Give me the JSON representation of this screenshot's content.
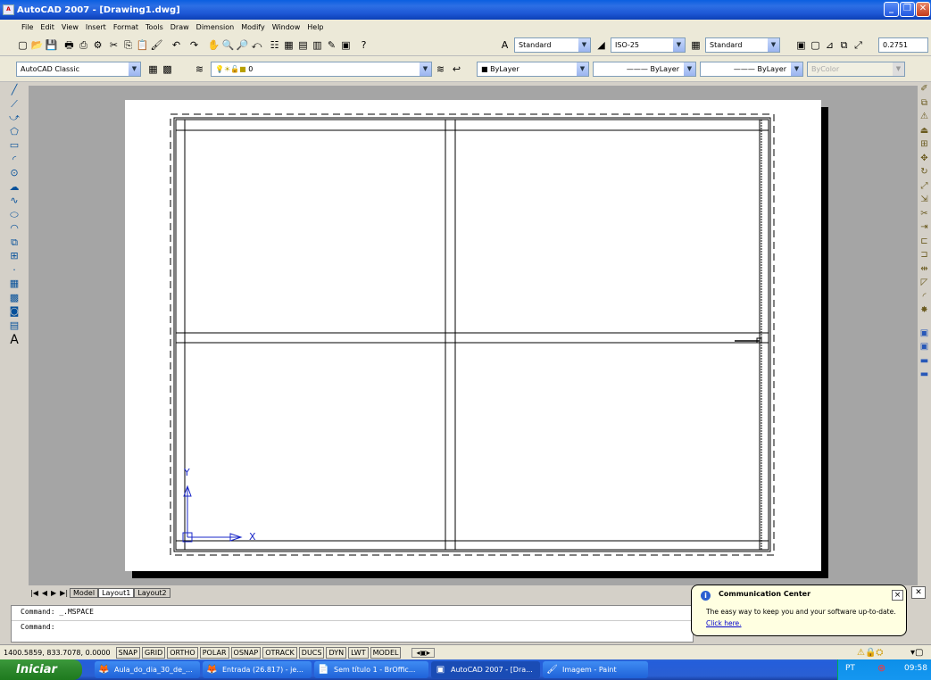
{
  "window": {
    "title": "AutoCAD 2007 - [Drawing1.dwg]"
  },
  "menu": [
    "File",
    "Edit",
    "View",
    "Insert",
    "Format",
    "Tools",
    "Draw",
    "Dimension",
    "Modify",
    "Window",
    "Help"
  ],
  "styles": {
    "text_style": "Standard",
    "dim_style": "ISO-25",
    "table_style": "Standard",
    "value_field": "0.2751"
  },
  "workspace": "AutoCAD Classic",
  "layer": {
    "current": "0",
    "color": "ByLayer",
    "linetype": "ByLayer",
    "lineweight": "ByLayer",
    "plotstyle": "ByColor"
  },
  "layout_tabs": [
    "Model",
    "Layout1",
    "Layout2"
  ],
  "command_lines": [
    "Command:  _.MSPACE",
    "Command:"
  ],
  "status": {
    "coords": "1400.5859, 833.7078, 0.0000",
    "toggles": [
      "SNAP",
      "GRID",
      "ORTHO",
      "POLAR",
      "OSNAP",
      "OTRACK",
      "DUCS",
      "DYN",
      "LWT",
      "MODEL"
    ]
  },
  "ucs": {
    "x_label": "X",
    "y_label": "Y"
  },
  "balloon": {
    "title": "Communication Center",
    "text": "The easy way to keep you and your software up-to-date.",
    "link": "Click here.",
    "close": "×"
  },
  "taskbar": {
    "start": "Iniciar",
    "tasks": [
      "Aula_do_dia_30_de_...",
      "Entrada (26.817) - je...",
      "Sem título 1 - BrOffic...",
      "AutoCAD 2007 - [Dra...",
      "Imagem - Paint"
    ],
    "lang": "PT",
    "clock": "09:58"
  },
  "window_buttons": {
    "min": "_",
    "restore": "❐",
    "close": "✕"
  },
  "icons": {
    "left_toolbar": [
      "line",
      "construction-line",
      "polyline",
      "polygon",
      "rectangle",
      "arc",
      "circle",
      "revision-cloud",
      "spline",
      "ellipse",
      "ellipse-arc",
      "insert-block",
      "make-block",
      "point",
      "hatch",
      "gradient",
      "region",
      "table",
      "multiline-text"
    ]
  }
}
